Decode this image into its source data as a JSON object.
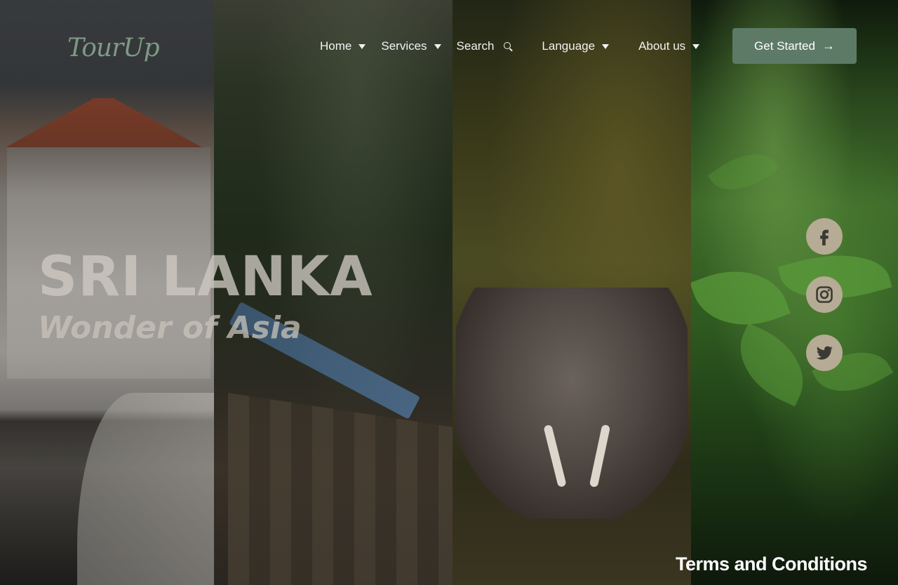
{
  "brand": {
    "logo_text": "TourUp"
  },
  "nav": {
    "home": "Home",
    "services": "Services",
    "search": "Search",
    "language": "Language",
    "about": "About us"
  },
  "cta": {
    "label": "Get Started",
    "arrow": "→"
  },
  "hero": {
    "title": "SRI LANKA",
    "subtitle": "Wonder of Asia"
  },
  "social": {
    "icons": [
      "facebook-icon",
      "instagram-icon",
      "twitter-icon"
    ],
    "color": "#b6ab94"
  },
  "footer": {
    "terms": "Terms and Conditions"
  },
  "colors": {
    "accent": "#5d7a67",
    "logo": "#7d9a86"
  }
}
